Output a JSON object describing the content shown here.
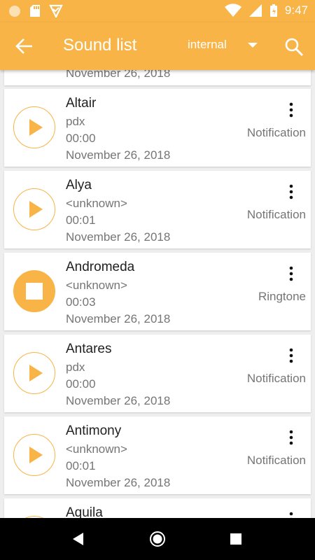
{
  "status_bar": {
    "time": "9:47",
    "icons": [
      "circle-notification-icon",
      "sd-card-icon",
      "download-check-icon",
      "wifi-icon",
      "signal-icon",
      "battery-icon"
    ]
  },
  "app_bar": {
    "title": "Sound list",
    "storage_selected": "internal",
    "back_icon": "arrow-back-icon",
    "search_icon": "search-icon"
  },
  "colors": {
    "accent": "#f8b447",
    "text_primary": "#212121",
    "text_secondary": "#757575",
    "background": "#eeeeee"
  },
  "partial_top_item": {
    "date": "November 26, 2018"
  },
  "sounds": [
    {
      "name": "Altair",
      "artist": "pdx",
      "duration": "00:00",
      "date": "November 26, 2018",
      "type": "Notification",
      "playing": false
    },
    {
      "name": "Alya",
      "artist": "<unknown>",
      "duration": "00:01",
      "date": "November 26, 2018",
      "type": "Notification",
      "playing": false
    },
    {
      "name": "Andromeda",
      "artist": "<unknown>",
      "duration": "00:03",
      "date": "November 26, 2018",
      "type": "Ringtone",
      "playing": true
    },
    {
      "name": "Antares",
      "artist": "pdx",
      "duration": "00:00",
      "date": "November 26, 2018",
      "type": "Notification",
      "playing": false
    },
    {
      "name": "Antimony",
      "artist": "<unknown>",
      "duration": "00:01",
      "date": "November 26, 2018",
      "type": "Notification",
      "playing": false
    }
  ],
  "partial_bottom_item": {
    "name": "Aquila"
  }
}
